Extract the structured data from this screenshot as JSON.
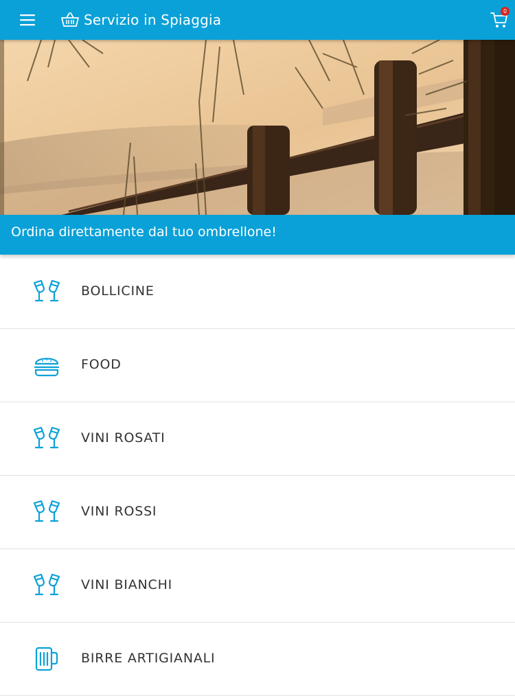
{
  "header": {
    "title": "Servizio in Spiaggia",
    "cart_count": "0",
    "menu_icon": "hamburger-menu-icon",
    "logo_icon": "basket-icon",
    "cart_icon": "shopping-cart-icon",
    "bar_color": "#0aa1d8",
    "badge_color": "#d7251f"
  },
  "hero": {
    "image": "beach-sand-fence-photo"
  },
  "banner": {
    "text": "Ordina direttamente dal tuo ombrellone!"
  },
  "categories": [
    {
      "label": "BOLLICINE",
      "icon": "wine-glasses-toast-icon"
    },
    {
      "label": "FOOD",
      "icon": "burger-icon"
    },
    {
      "label": "VINI ROSATI",
      "icon": "wine-glasses-toast-icon"
    },
    {
      "label": "VINI ROSSI",
      "icon": "wine-glasses-toast-icon"
    },
    {
      "label": "VINI BIANCHI",
      "icon": "wine-glasses-toast-icon"
    },
    {
      "label": "BIRRE ARTIGIANALI",
      "icon": "beer-mug-icon"
    }
  ]
}
